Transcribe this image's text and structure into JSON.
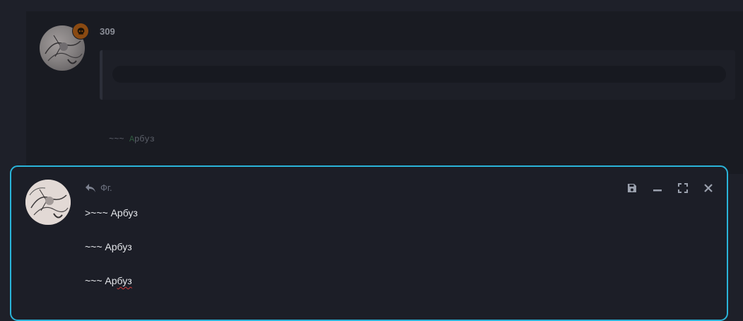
{
  "post": {
    "username": "309",
    "content_prefix": "~~~ ",
    "content_green": "А",
    "content_rest": "рбуз"
  },
  "editor": {
    "reply_to": "Фг.",
    "lines": [
      ">~~~ Арбуз",
      "~~~ Арбуз"
    ],
    "last_line_prefix": "~~~ Ар",
    "last_line_misspelled": "буз"
  },
  "colors": {
    "accent_border": "#2ab4d9",
    "badge": "#8a4a12",
    "background": "#1e2029"
  },
  "icons": [
    "skull-icon",
    "reply-icon",
    "save-icon",
    "minimize-icon",
    "expand-icon",
    "close-icon"
  ]
}
